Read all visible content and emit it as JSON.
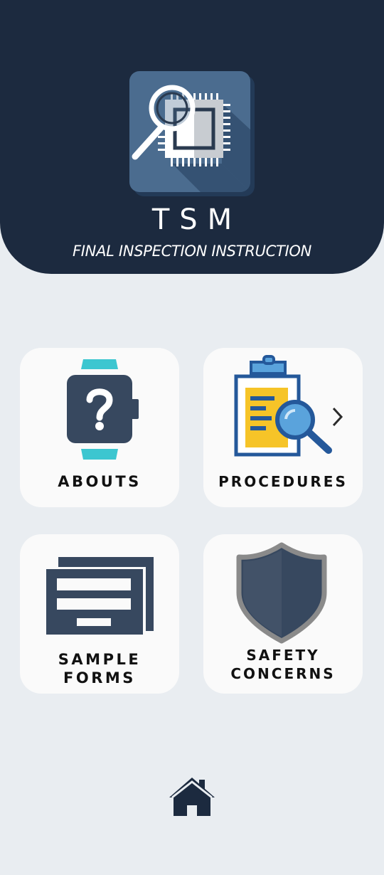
{
  "header": {
    "title": "TSM",
    "subtitle": "FINAL INSPECTION INSTRUCTION",
    "logo_icon": "chip-inspection-icon"
  },
  "menu": {
    "tiles": [
      {
        "label": "ABOUTS",
        "icon": "smartwatch-question-icon"
      },
      {
        "label": "PROCEDURES",
        "icon": "clipboard-magnifier-icon"
      },
      {
        "label": "SAMPLE\nFORMS",
        "icon": "forms-icon"
      },
      {
        "label": "SAFETY\nCONCERNS",
        "icon": "shield-icon"
      }
    ]
  },
  "footer": {
    "home_icon": "home-icon"
  },
  "colors": {
    "header_bg": "#1c2a3f",
    "page_bg": "#e9edf1",
    "tile_bg": "#fafafa",
    "icon_dark": "#37485f",
    "accent_teal": "#3cc6d0",
    "accent_yellow": "#f6c428",
    "accent_blue": "#5aa3dc"
  }
}
